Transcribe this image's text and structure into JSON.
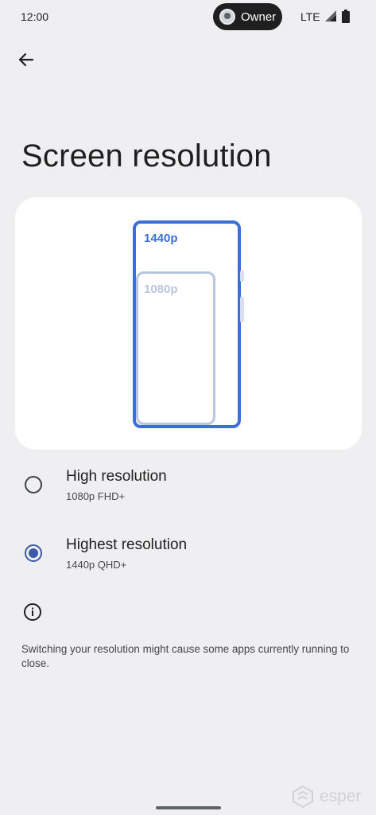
{
  "status_bar": {
    "time": "12:00",
    "owner_label": "Owner",
    "network": "LTE"
  },
  "page": {
    "title": "Screen resolution"
  },
  "preview": {
    "label_large": "1440p",
    "label_small": "1080p"
  },
  "options": [
    {
      "title": "High resolution",
      "subtitle": "1080p FHD+",
      "selected": false
    },
    {
      "title": "Highest resolution",
      "subtitle": "1440p QHD+",
      "selected": true
    }
  ],
  "info": {
    "text": "Switching your resolution might cause some apps currently running to close."
  },
  "watermark": {
    "text": "esper"
  },
  "colors": {
    "background": "#efeff1",
    "accent": "#3a6fd8",
    "radio_selected": "#3c5aa8"
  }
}
